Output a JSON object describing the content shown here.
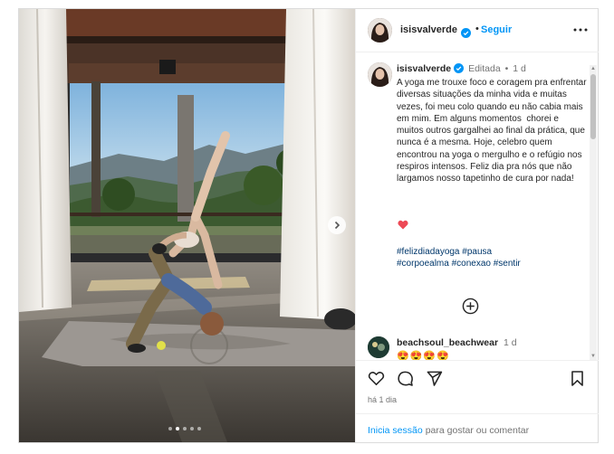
{
  "post": {
    "author": {
      "username": "isisvalverde",
      "verified": true,
      "follow_label": "Seguir",
      "separator": "•"
    },
    "media": {
      "description_icon": "yoga-photo",
      "carousel_dots": 5,
      "active_dot": 1
    },
    "caption": {
      "username": "isisvalverde",
      "edited_label": "Editada",
      "age": "1 d",
      "text": "A yoga me trouxe foco e coragem pra enfrentar diversas situações da minha vida e muitas vezes, foi meu colo quando eu não cabia mais em mim. Em alguns momentos  chorei e muitos outros gargalhei ao final da prática, que nunca é a mesma. Hoje, celebro quem encontrou na yoga o mergulho e o refúgio nos respiros intensos. Feliz dia pra nós que não largamos nosso tapetinho de cura por nada!",
      "emoji": "red-heart",
      "hashtags": [
        "#felizdiadayoga",
        "#pausa",
        "#corpoealma",
        "#conexao",
        "#sentir"
      ]
    },
    "comments": [
      {
        "username": "beachsoul_beachwear",
        "age": "1 d",
        "text": "😍😍😍😍"
      }
    ],
    "actions": {
      "like_icon": "heart-icon",
      "comment_icon": "comment-icon",
      "share_icon": "send-icon",
      "save_icon": "bookmark-icon"
    },
    "timestamp": "há 1 dia",
    "login_prompt": {
      "link": "Inicia sessão",
      "rest": "para gostar ou comentar"
    }
  },
  "colors": {
    "link_blue": "#0095f6",
    "hashtag_blue": "#00376b",
    "muted_text": "#737373",
    "heart_red": "#ed4956",
    "divider": "#efefef"
  }
}
